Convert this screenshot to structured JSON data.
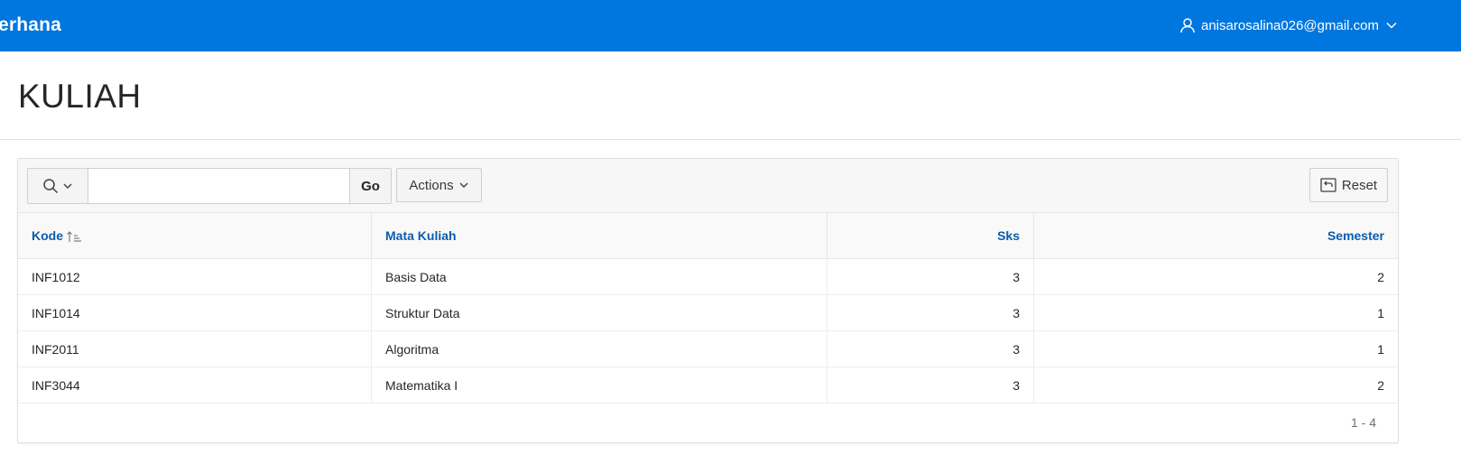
{
  "header": {
    "app_title": "erhana",
    "user_email": "anisarosalina026@gmail.com",
    "user_icon": "user-icon",
    "menu_icon": "chevron-down-icon",
    "brand_color": "#0076df"
  },
  "page": {
    "title": "KULIAH"
  },
  "toolbar": {
    "search_icon": "search-icon",
    "search_value": "",
    "search_placeholder": "",
    "go_label": "Go",
    "actions_label": "Actions",
    "reset_label": "Reset",
    "reset_icon": "reset-icon"
  },
  "table": {
    "columns": [
      "Kode",
      "Mata Kuliah",
      "Sks",
      "Semester"
    ],
    "sorted_column": "Kode",
    "sort_direction": "ascending",
    "rows": [
      {
        "kode": "INF1012",
        "mata_kuliah": "Basis Data",
        "sks": "3",
        "semester": "2"
      },
      {
        "kode": "INF1014",
        "mata_kuliah": "Struktur Data",
        "sks": "3",
        "semester": "1"
      },
      {
        "kode": "INF2011",
        "mata_kuliah": "Algoritma",
        "sks": "3",
        "semester": "1"
      },
      {
        "kode": "INF3044",
        "mata_kuliah": "Matematika I",
        "sks": "3",
        "semester": "2"
      }
    ]
  },
  "pagination": {
    "range": "1 - 4"
  }
}
